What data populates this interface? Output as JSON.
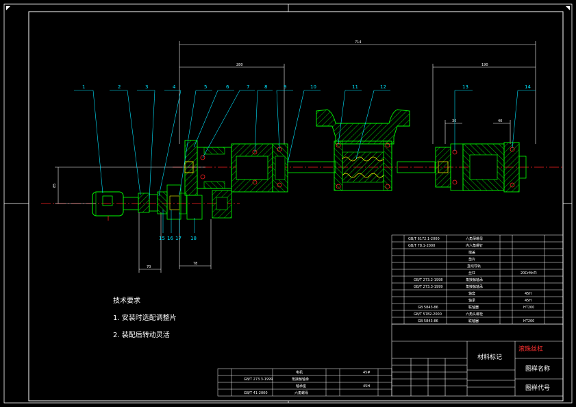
{
  "drawing": {
    "title": "滚珠丝杠",
    "part_name_label": "图样名称",
    "part_code_label": "图样代号",
    "material_label": "材料标记",
    "balloons": [
      "1",
      "2",
      "3",
      "4",
      "5",
      "6",
      "7",
      "8",
      "9",
      "10",
      "11",
      "12",
      "13",
      "14",
      "15",
      "16",
      "17",
      "18"
    ],
    "dimensions": {
      "overall": "714",
      "left_span": "280",
      "right_span": "190",
      "height": "85",
      "bottom_left": "70",
      "bottom_mid": "78",
      "right_small_1": "30",
      "right_small_2": "40"
    },
    "notes": {
      "heading": "技术要求",
      "line1": "1. 安装时选配调整片",
      "line2": "2. 装配后转动灵活"
    },
    "parts_list": [
      {
        "no": "",
        "std": "GB/T 6172.1-2000",
        "name": "六角薄螺母",
        "mat": ""
      },
      {
        "no": "",
        "std": "GB/T 78.1-2000",
        "name": "内六角螺钉",
        "mat": ""
      },
      {
        "no": "",
        "std": "",
        "name": "端盖",
        "mat": ""
      },
      {
        "no": "",
        "std": "",
        "name": "垫片",
        "mat": ""
      },
      {
        "no": "",
        "std": "",
        "name": "直线导轨",
        "mat": ""
      },
      {
        "no": "",
        "std": "",
        "name": "丝杠",
        "mat": "20CrMnTi"
      },
      {
        "no": "",
        "std": "GB/T 273.2-1998",
        "name": "角接触轴承",
        "mat": ""
      },
      {
        "no": "",
        "std": "GB/T 273.3-1999",
        "name": "角接触轴承",
        "mat": ""
      },
      {
        "no": "",
        "std": "",
        "name": "轴套",
        "mat": "45H"
      },
      {
        "no": "",
        "std": "",
        "name": "轴承",
        "mat": "45H"
      },
      {
        "no": "",
        "std": "GB 5843-86",
        "name": "联轴器",
        "mat": "HT200"
      },
      {
        "no": "",
        "std": "GB/T 5782-2000",
        "name": "六角头螺栓",
        "mat": ""
      },
      {
        "no": "",
        "std": "GB 5843-86",
        "name": "联轴器",
        "mat": "HT200"
      }
    ],
    "bottom_list": [
      {
        "no": "",
        "std": "",
        "name": "电机",
        "mat": ""
      },
      {
        "no": "",
        "std": "GB/T 273.3-1999",
        "name": "角接触轴承",
        "mat": "45#"
      },
      {
        "no": "",
        "std": "",
        "name": "轴承座",
        "mat": "45H"
      },
      {
        "no": "",
        "std": "GB/T 41-2000",
        "name": "六角螺母",
        "mat": ""
      }
    ],
    "colors": {
      "background": "#000000",
      "outline": "#00ff00",
      "center_line": "#ff2020",
      "leader": "#00e5ff",
      "dimension": "#ffffff",
      "hatch": "#00ff00",
      "accent": "#ffff00"
    }
  }
}
